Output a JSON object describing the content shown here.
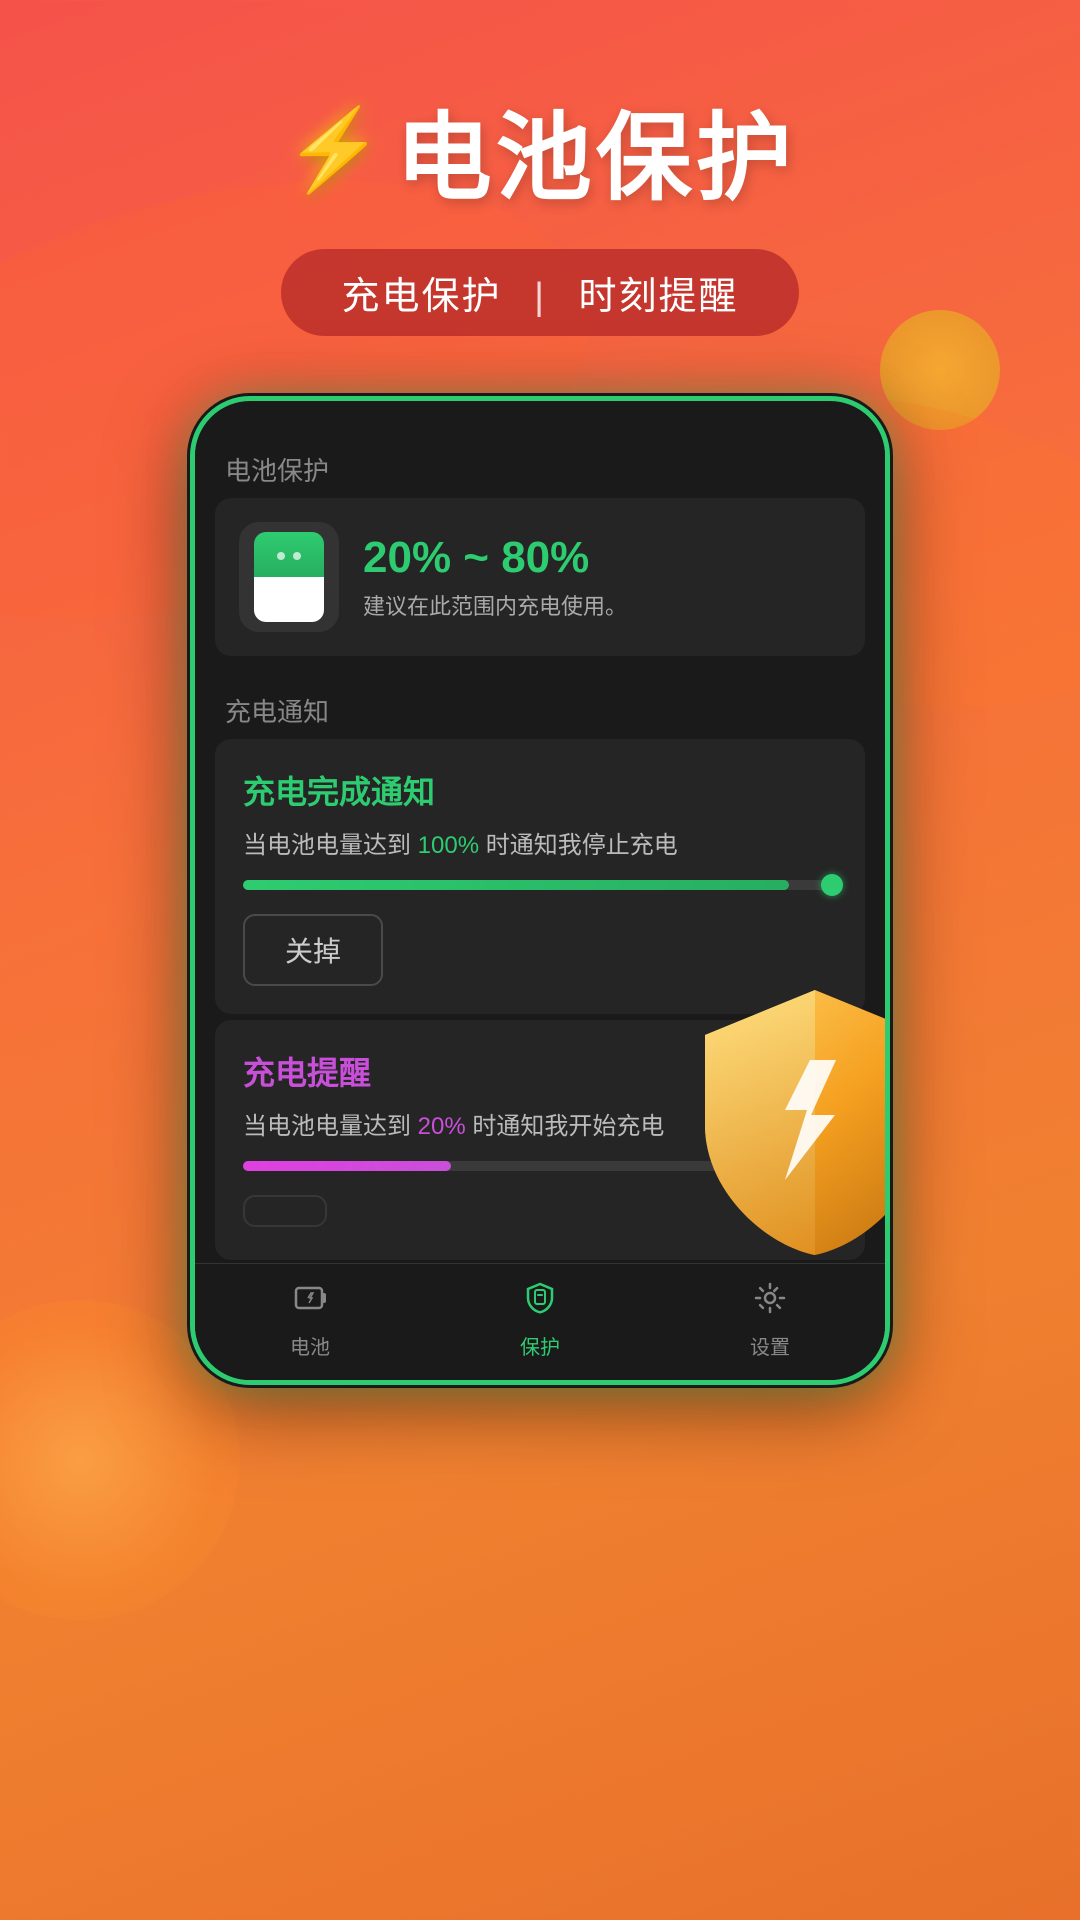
{
  "header": {
    "title": "电池保护",
    "lightning": "⚡",
    "subtitle": "充电保护",
    "subtitle_divider": "|",
    "subtitle_right": "时刻提醒"
  },
  "phone": {
    "section1_label": "电池保护",
    "battery_range": "20% ~ 80%",
    "battery_desc": "建议在此范围内充电使用。",
    "section2_label": "充电通知",
    "notif1_title": "充电完成通知",
    "notif1_desc_pre": "当电池电量达到",
    "notif1_highlight": "100%",
    "notif1_desc_post": "时通知我停止充电",
    "notif1_slider_pct": 92,
    "notif1_btn": "关掉",
    "notif2_title": "充电提醒",
    "notif2_desc_pre": "当电池电量达到",
    "notif2_highlight": "20%",
    "notif2_desc_post": "时通知我开始充电",
    "notif2_slider_pct": 35
  },
  "bottom_nav": {
    "items": [
      {
        "label": "电池",
        "icon": "⚡",
        "active": false
      },
      {
        "label": "保护",
        "icon": "🛡",
        "active": true
      },
      {
        "label": "设置",
        "icon": "⚙",
        "active": false
      }
    ]
  }
}
